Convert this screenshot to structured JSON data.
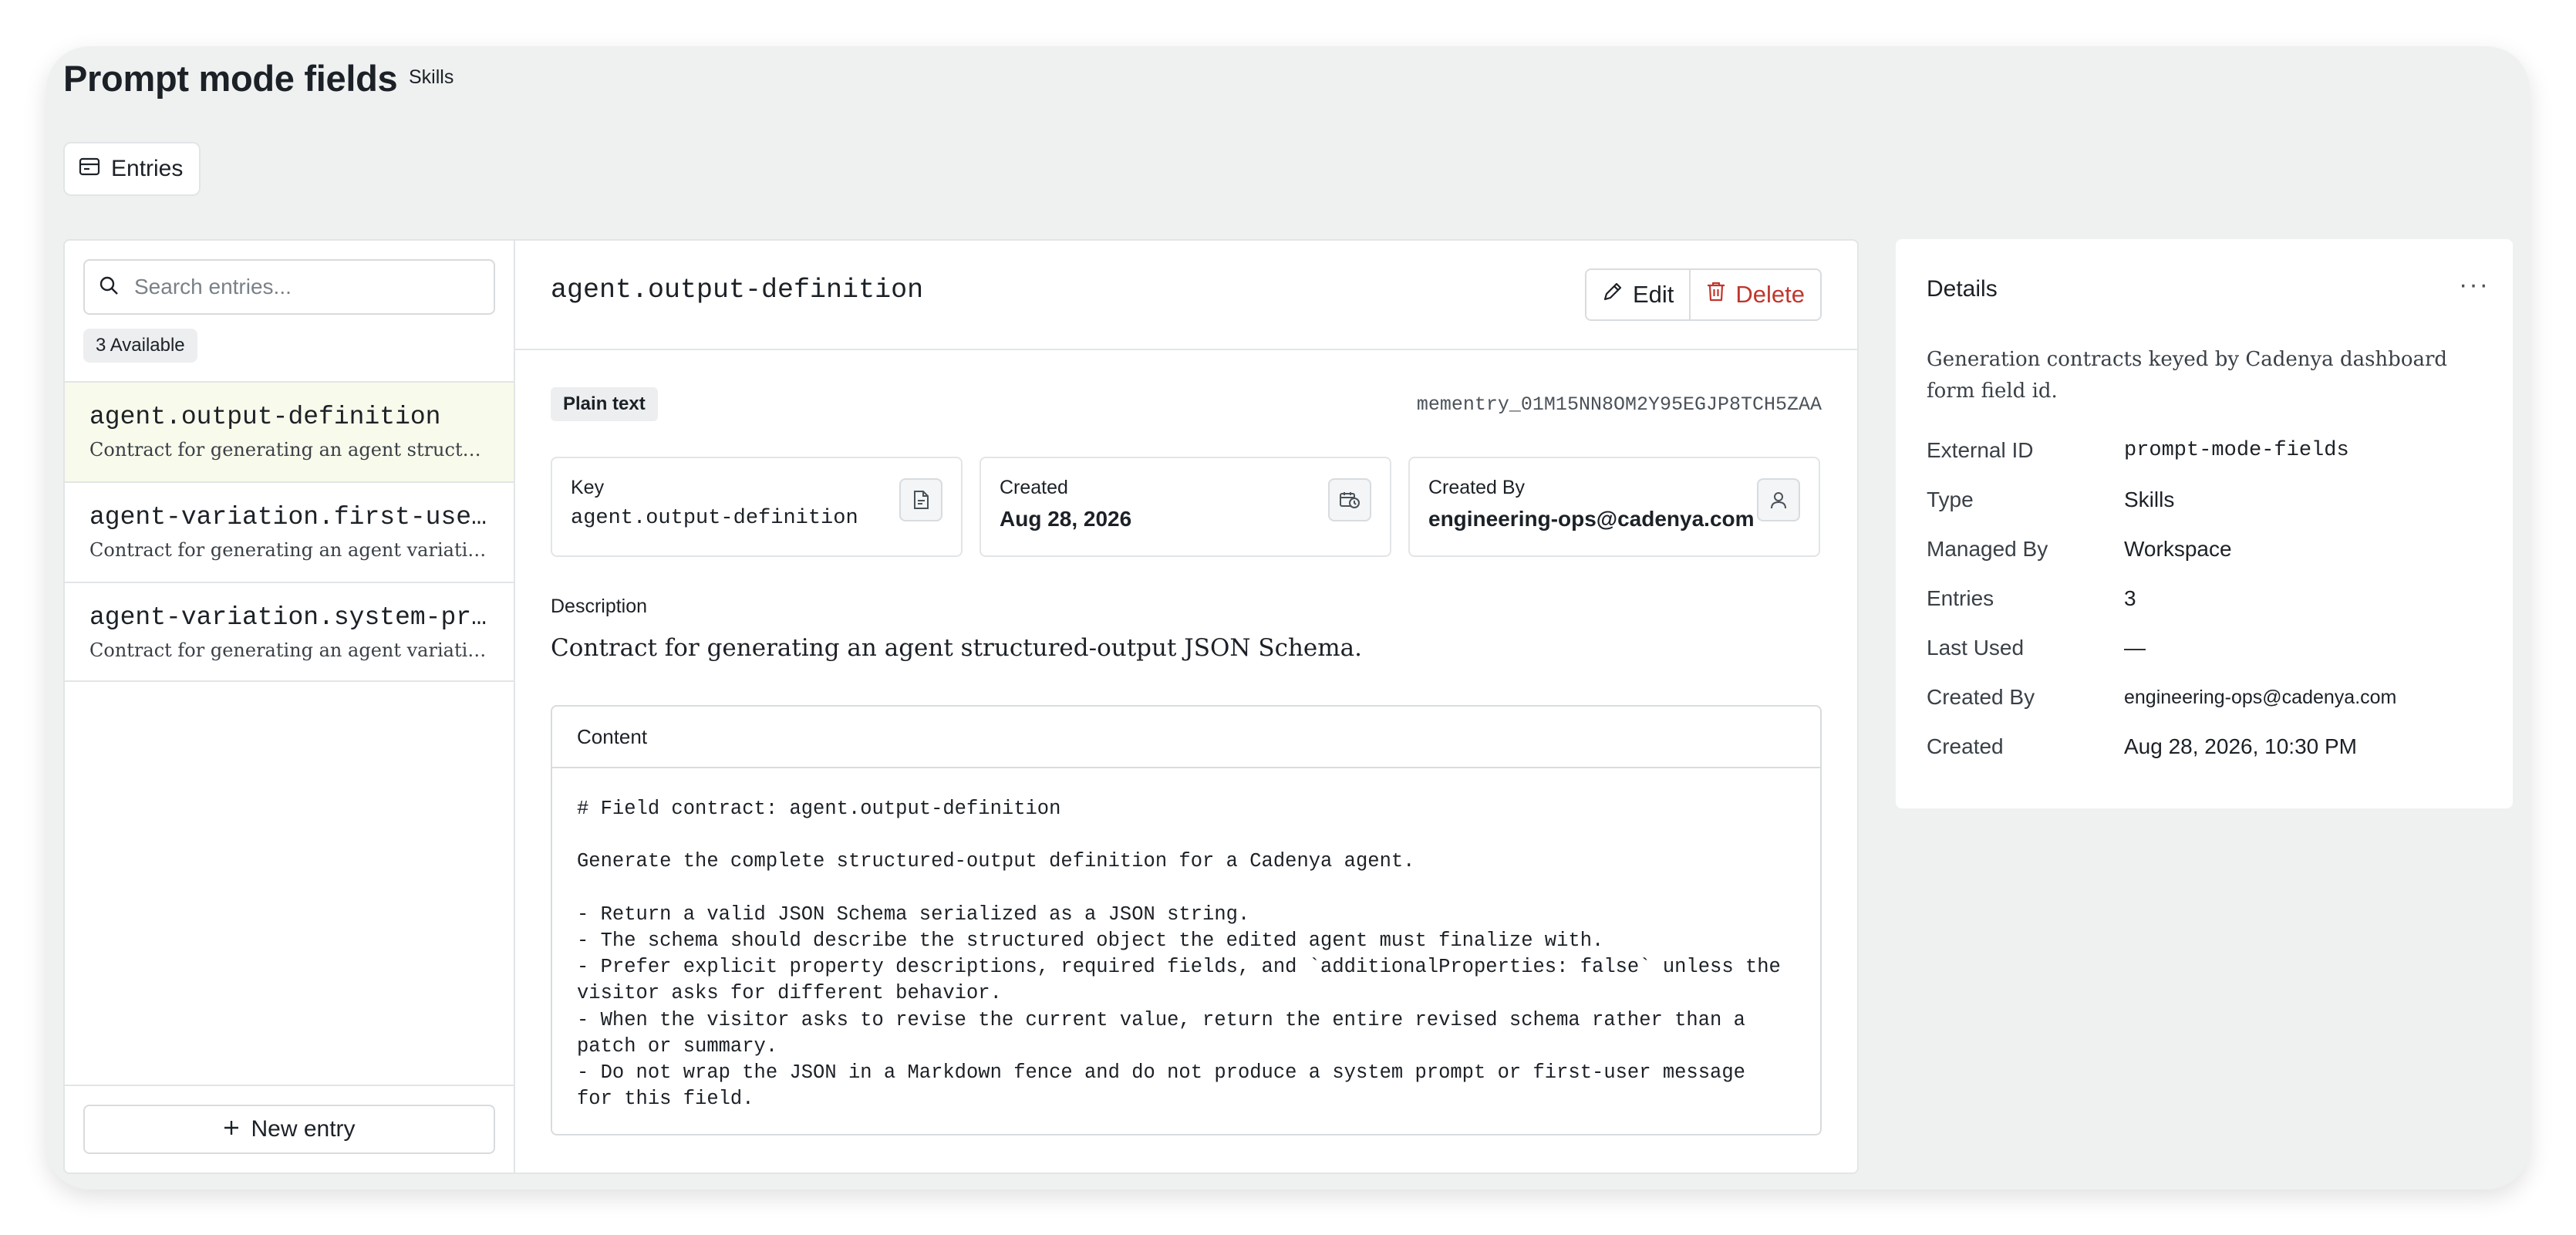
{
  "header": {
    "title": "Prompt mode fields",
    "tag": "Skills",
    "entries_button": "Entries"
  },
  "left": {
    "search_placeholder": "Search entries...",
    "available_badge": "3 Available",
    "entries": [
      {
        "title": "agent.output-definition",
        "subtitle": "Contract for generating an agent structured-output JSON Schema.",
        "selected": true
      },
      {
        "title": "agent-variation.first-user-message",
        "subtitle": "Contract for generating an agent variation first-user message.",
        "selected": false
      },
      {
        "title": "agent-variation.system-prompt",
        "subtitle": "Contract for generating an agent variation system prompt.",
        "selected": false
      }
    ],
    "new_entry_label": "New entry"
  },
  "detail": {
    "key": "agent.output-definition",
    "edit_label": "Edit",
    "delete_label": "Delete",
    "format_chip": "Plain text",
    "memory_id": "mementry_01M15NN8OM2Y95EGJP8TCH5ZAA",
    "cards": {
      "key": {
        "label": "Key",
        "value": "agent.output-definition"
      },
      "created": {
        "label": "Created",
        "value": "Aug 28, 2026"
      },
      "created_by": {
        "label": "Created By",
        "value": "engineering-ops@cadenya.com"
      }
    },
    "description_label": "Description",
    "description": "Contract for generating an agent structured-output JSON Schema.",
    "content_label": "Content",
    "content": "# Field contract: agent.output-definition\n\nGenerate the complete structured-output definition for a Cadenya agent.\n\n- Return a valid JSON Schema serialized as a JSON string.\n- The schema should describe the structured object the edited agent must finalize with.\n- Prefer explicit property descriptions, required fields, and `additionalProperties: false` unless the\nvisitor asks for different behavior.\n- When the visitor asks to revise the current value, return the entire revised schema rather than a\npatch or summary.\n- Do not wrap the JSON in a Markdown fence and do not produce a system prompt or first-user message\nfor this field."
  },
  "details_panel": {
    "title": "Details",
    "more_label": "···",
    "description": "Generation contracts keyed by Cadenya dashboard form field id.",
    "rows": [
      {
        "label": "External ID",
        "value": "prompt-mode-fields"
      },
      {
        "label": "Type",
        "value": "Skills"
      },
      {
        "label": "Managed By",
        "value": "Workspace"
      },
      {
        "label": "Entries",
        "value": "3"
      },
      {
        "label": "Last Used",
        "value": "—"
      },
      {
        "label": "Created By",
        "value": "engineering-ops@cadenya.com"
      },
      {
        "label": "Created",
        "value": "Aug 28, 2026, 10:30 PM"
      }
    ]
  },
  "colors": {
    "background": "#eff1f1",
    "selected_row": "#f8faeb",
    "delete_red": "#c0362c",
    "border": "#e2e5e7"
  },
  "icons": {
    "entries": "table-icon",
    "search": "search-icon",
    "new_entry": "plus-icon",
    "edit": "pencil-icon",
    "delete": "trash-icon",
    "key_card": "document-icon",
    "created_card": "calendar-clock-icon",
    "created_by_card": "user-icon",
    "details_menu": "more-horizontal-icon"
  }
}
